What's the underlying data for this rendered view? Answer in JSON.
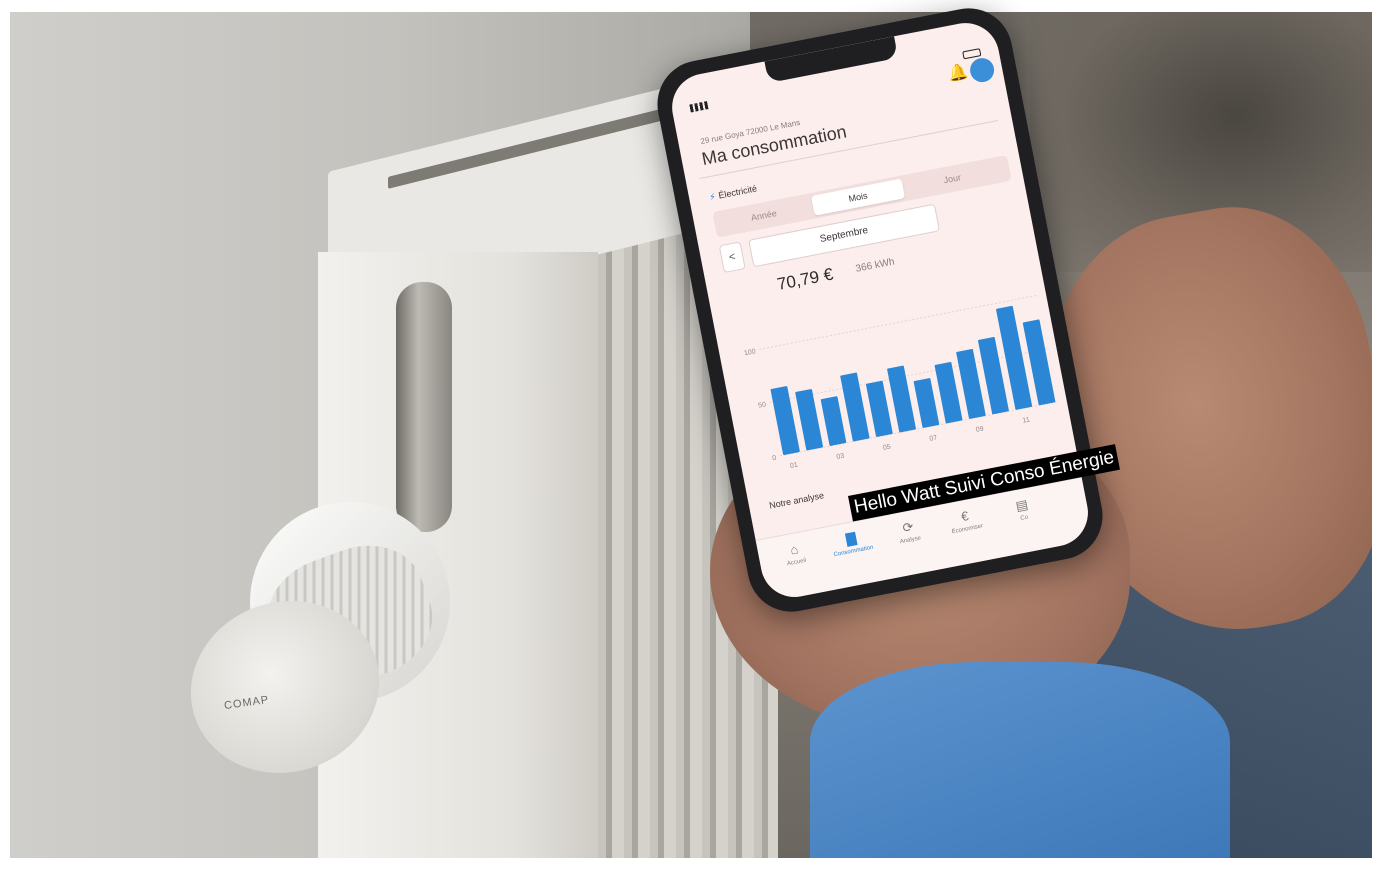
{
  "scene": {
    "valve_brand": "COMAP"
  },
  "app": {
    "address": "29 rue Goya 72000 Le Mans",
    "title": "Ma consommation",
    "energy_label": "Électricité",
    "tabs": [
      "Année",
      "Mois",
      "Jour"
    ],
    "active_tab": "Mois",
    "period_label": "Septembre",
    "prev_label": "<",
    "amount": "70,79 €",
    "consumption": "366 kWh",
    "analysis_title": "Notre analyse",
    "accent_color": "#2b86d6",
    "nav": [
      {
        "label": "Accueil",
        "icon": "home-icon"
      },
      {
        "label": "Consommation",
        "icon": "bar-chart-icon",
        "active": true
      },
      {
        "label": "Analyse",
        "icon": "history-icon"
      },
      {
        "label": "Économiser",
        "icon": "euro-icon"
      },
      {
        "label": "Co",
        "icon": "document-icon"
      }
    ]
  },
  "chart_data": {
    "type": "bar",
    "ylim": [
      0,
      120
    ],
    "yticks": [
      "100",
      "50",
      "0"
    ],
    "xticks": [
      "01",
      "03",
      "05",
      "07",
      "09",
      "11"
    ],
    "values": [
      62,
      55,
      44,
      62,
      50,
      60,
      44,
      55,
      63,
      70,
      95,
      78
    ],
    "color": "#2b86d6"
  },
  "caption": "Hello Watt Suivi Conso Énergie"
}
